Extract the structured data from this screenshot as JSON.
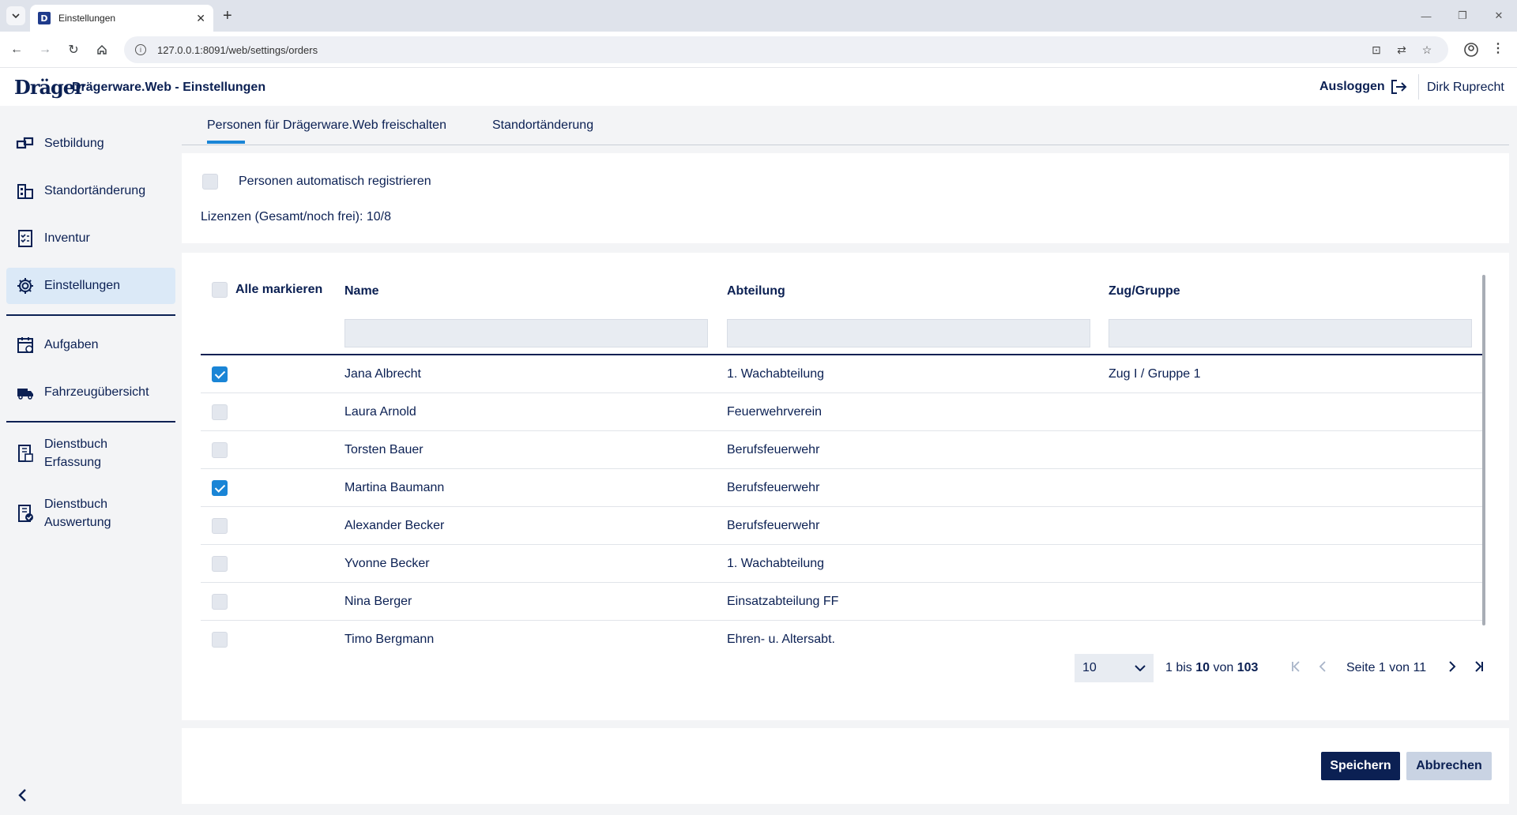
{
  "browser": {
    "tab_title": "Einstellungen",
    "favicon_letter": "D",
    "url": "127.0.0.1:8091/web/settings/orders"
  },
  "header": {
    "logo": "Dräger",
    "title": "Drägerware.Web - Einstellungen",
    "logout": "Ausloggen",
    "user": "Dirk Ruprecht"
  },
  "sidebar": {
    "items": [
      {
        "label": "Setbildung",
        "icon": "set-icon"
      },
      {
        "label": "Standortänderung",
        "icon": "building-icon"
      },
      {
        "label": "Inventur",
        "icon": "checklist-icon"
      },
      {
        "label": "Einstellungen",
        "icon": "gear-icon",
        "active": true
      },
      {
        "label": "Aufgaben",
        "icon": "calendar-icon"
      },
      {
        "label": "Fahrzeugübersicht",
        "icon": "truck-icon"
      },
      {
        "label_line1": "Dienstbuch",
        "label_line2": "Erfassung",
        "icon": "book-edit-icon"
      },
      {
        "label_line1": "Dienstbuch",
        "label_line2": "Auswertung",
        "icon": "book-check-icon"
      }
    ]
  },
  "tabs": [
    {
      "label": "Personen für Drägerware.Web freischalten",
      "active": true
    },
    {
      "label": "Standortänderung"
    }
  ],
  "settings": {
    "auto_register_label": "Personen automatisch registrieren",
    "auto_register_checked": false,
    "licenses": "Lizenzen (Gesamt/noch frei): 10/8"
  },
  "table": {
    "select_all_label": "Alle markieren",
    "columns": [
      "Name",
      "Abteilung",
      "Zug/Gruppe"
    ],
    "rows": [
      {
        "checked": true,
        "name": "Jana Albrecht",
        "dept": "1. Wachabteilung",
        "group": "Zug I / Gruppe 1"
      },
      {
        "checked": false,
        "name": "Laura Arnold",
        "dept": "Feuerwehrverein",
        "group": ""
      },
      {
        "checked": false,
        "name": "Torsten Bauer",
        "dept": "Berufsfeuerwehr",
        "group": ""
      },
      {
        "checked": true,
        "name": "Martina Baumann",
        "dept": "Berufsfeuerwehr",
        "group": ""
      },
      {
        "checked": false,
        "name": "Alexander Becker",
        "dept": "Berufsfeuerwehr",
        "group": ""
      },
      {
        "checked": false,
        "name": "Yvonne Becker",
        "dept": "1. Wachabteilung",
        "group": ""
      },
      {
        "checked": false,
        "name": "Nina Berger",
        "dept": "Einsatzabteilung FF",
        "group": ""
      },
      {
        "checked": false,
        "name": "Timo Bergmann",
        "dept": "Ehren- u. Altersabt.",
        "group": ""
      }
    ]
  },
  "pagination": {
    "page_size": "10",
    "range_prefix": "1 bis",
    "range_to": "10",
    "range_of": "von",
    "total": "103",
    "page_label": "Seite 1 von 11"
  },
  "actions": {
    "save": "Speichern",
    "cancel": "Abbrechen"
  },
  "colors": {
    "brand": "#0b2053",
    "accent": "#1a85d6",
    "active_bg": "#dbe9f7"
  }
}
